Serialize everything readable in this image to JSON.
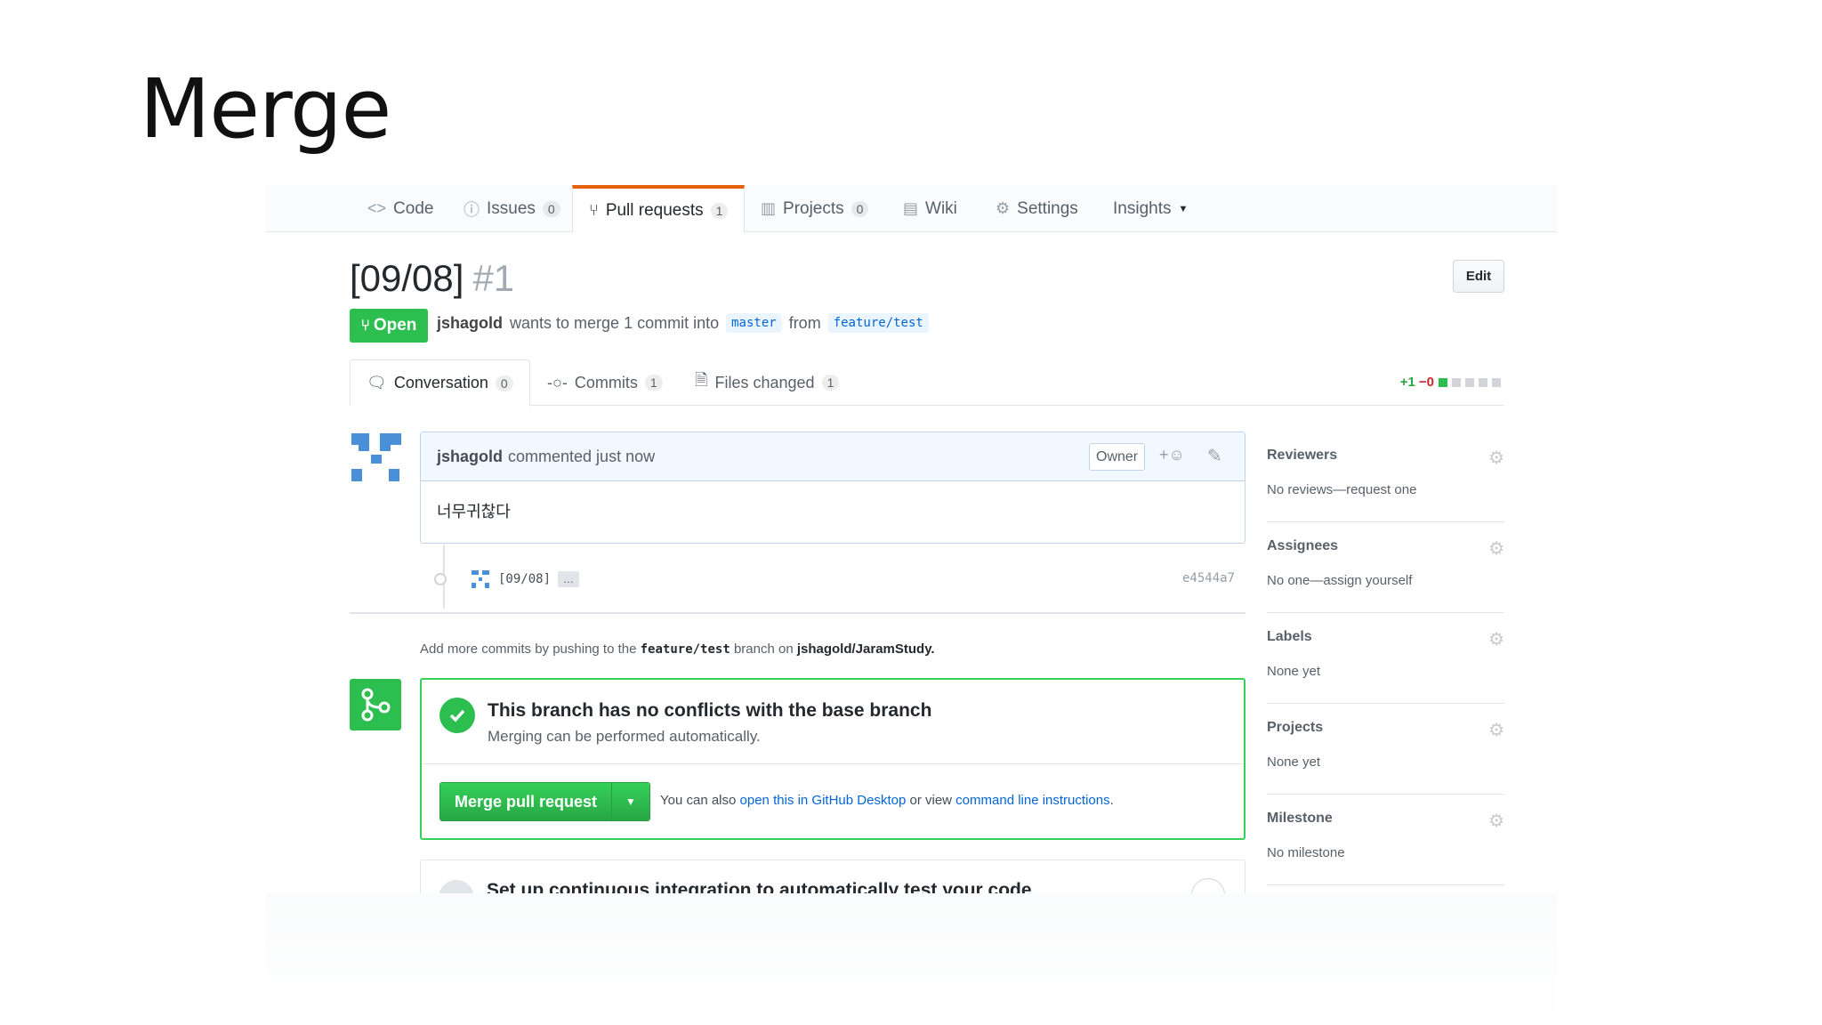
{
  "slide": {
    "title": "Merge"
  },
  "repo_nav": {
    "code": "Code",
    "issues": "Issues",
    "issues_count": "0",
    "pulls": "Pull requests",
    "pulls_count": "1",
    "projects": "Projects",
    "projects_count": "0",
    "wiki": "Wiki",
    "settings": "Settings",
    "insights": "Insights"
  },
  "pr": {
    "title": "[09/08]",
    "number": "#1",
    "edit": "Edit",
    "state": "Open",
    "author": "jshagold",
    "meta_text": "wants to merge 1 commit into",
    "base": "master",
    "from": "from",
    "head": "feature/test"
  },
  "tabs": {
    "conversation": "Conversation",
    "conversation_count": "0",
    "commits": "Commits",
    "commits_count": "1",
    "files": "Files changed",
    "files_count": "1",
    "additions": "+1",
    "deletions": "−0"
  },
  "comment": {
    "author": "jshagold",
    "action": "commented just now",
    "owner": "Owner",
    "body": "너무귀찮다"
  },
  "commit": {
    "message": "[09/08]",
    "ellipsis": "…",
    "sha": "e4544a7"
  },
  "push_hint": {
    "prefix": "Add more commits by pushing to the",
    "branch": "feature/test",
    "middle": "branch on",
    "repo": "jshagold/JaramStudy."
  },
  "merge": {
    "heading": "This branch has no conflicts with the base branch",
    "sub": "Merging can be performed automatically.",
    "button": "Merge pull request",
    "alt_prefix": "You can also",
    "alt_link1": "open this in GitHub Desktop",
    "alt_middle": "or view",
    "alt_link2": "command line instructions",
    "alt_suffix": "."
  },
  "ci": {
    "text": "Set up continuous integration to automatically test your code"
  },
  "sidebar": [
    {
      "label": "Reviewers",
      "value": "No reviews—request one"
    },
    {
      "label": "Assignees",
      "value": "No one—assign yourself"
    },
    {
      "label": "Labels",
      "value": "None yet"
    },
    {
      "label": "Projects",
      "value": "None yet"
    },
    {
      "label": "Milestone",
      "value": "No milestone"
    }
  ],
  "colors": {
    "accent_green": "#2cbe4e",
    "link_blue": "#0366d6",
    "tab_orange": "#e36209"
  }
}
